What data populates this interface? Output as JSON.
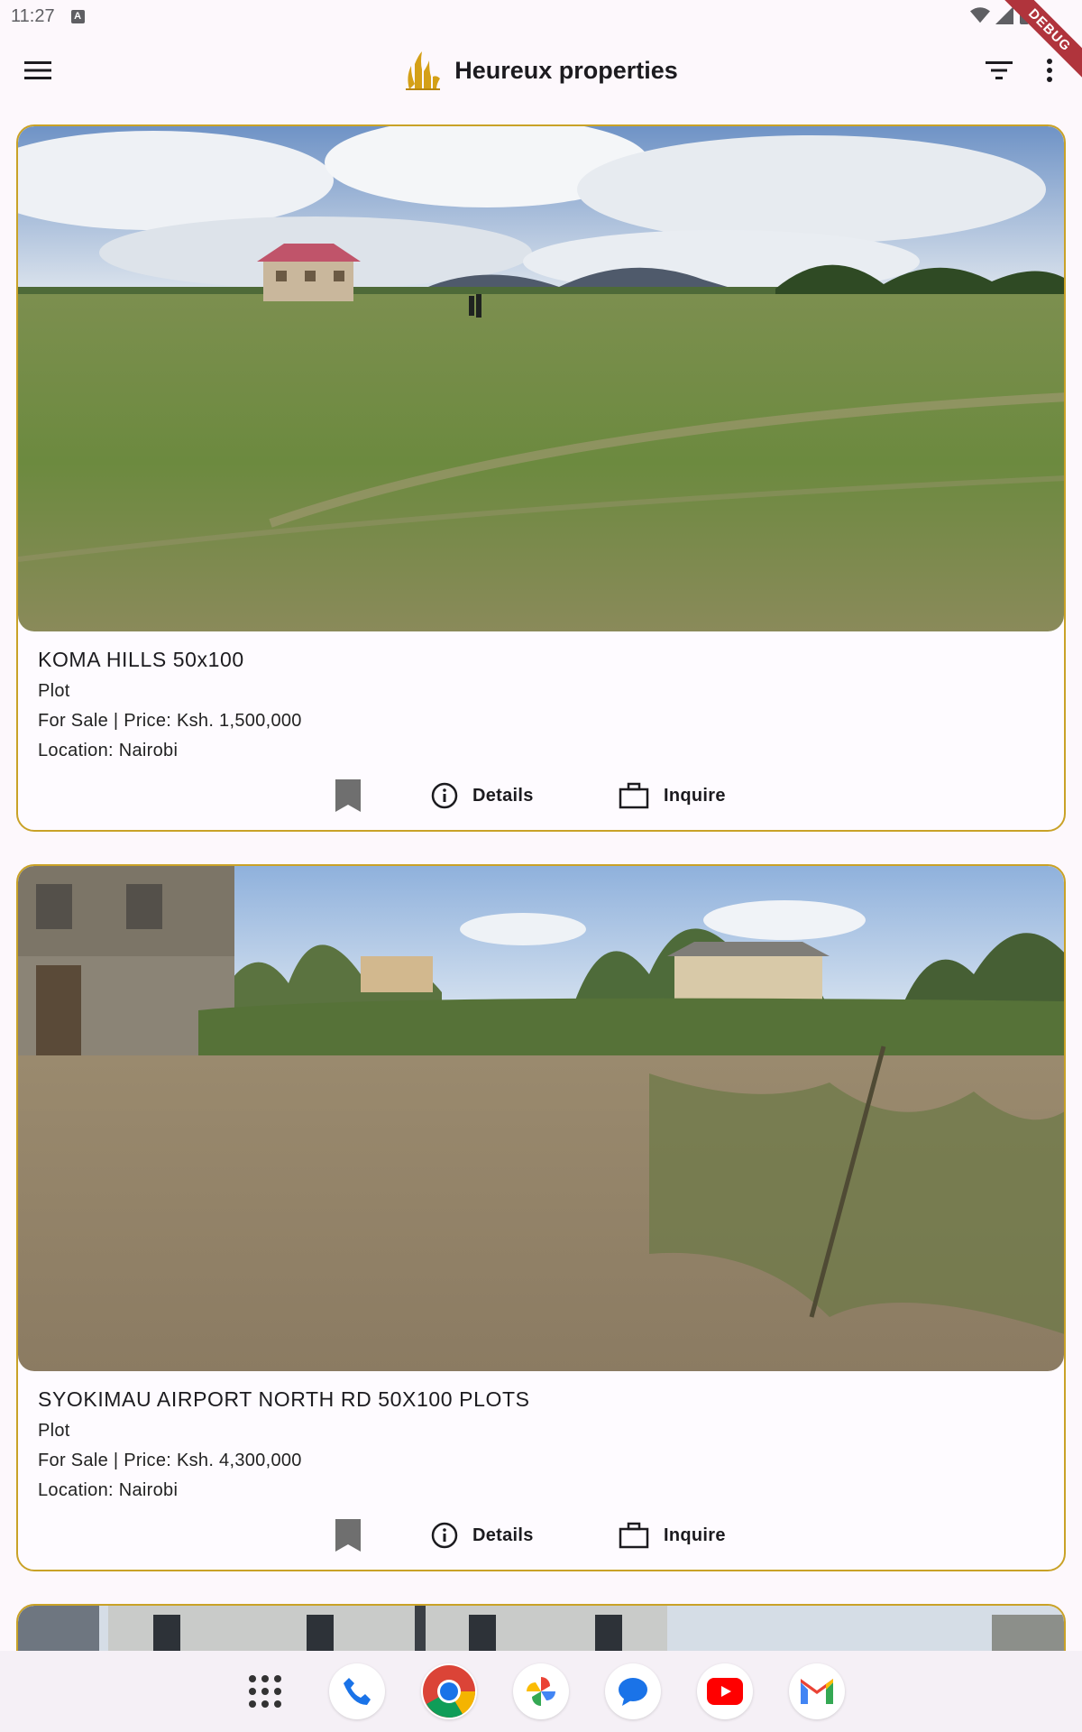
{
  "status_bar": {
    "time": "11:27",
    "badge": "A",
    "debug_label": "DEBUG"
  },
  "app_bar": {
    "title": "Heureux properties"
  },
  "listings": [
    {
      "title": "KOMA HILLS 50x100",
      "type": "Plot",
      "sale_price": "For Sale | Price: Ksh. 1,500,000",
      "location": "Location: Nairobi",
      "details_label": "Details",
      "inquire_label": "Inquire"
    },
    {
      "title": "SYOKIMAU AIRPORT NORTH RD 50X100 PLOTS",
      "type": "Plot",
      "sale_price": "For Sale | Price: Ksh. 4,300,000",
      "location": "Location: Nairobi",
      "details_label": "Details",
      "inquire_label": "Inquire"
    }
  ],
  "colors": {
    "card_border": "#c9a227",
    "brand_gold": "#d4a017",
    "background": "#fdf8fc"
  },
  "dock": [
    "app-grid-icon",
    "phone-icon",
    "chrome-icon",
    "photos-icon",
    "messages-icon",
    "youtube-icon",
    "gmail-icon"
  ]
}
